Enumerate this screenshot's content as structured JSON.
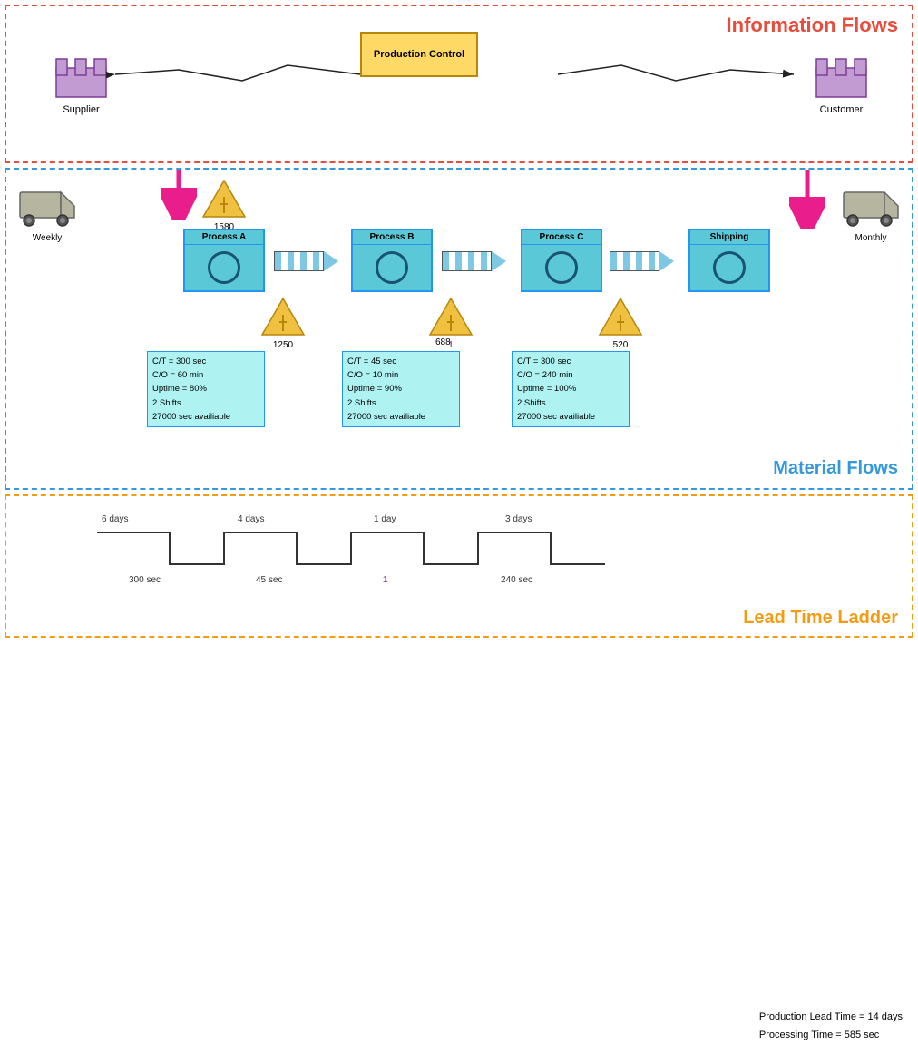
{
  "sections": {
    "info_flows": "Information Flows",
    "material_flows": "Material Flows",
    "lead_time": "Lead Time Ladder"
  },
  "production_control": {
    "label": "Production Control"
  },
  "supplier": {
    "label": "Supplier"
  },
  "customer": {
    "label": "Customer"
  },
  "truck_weekly": {
    "label": "Weekly"
  },
  "truck_monthly": {
    "label": "Monthly"
  },
  "processes": [
    {
      "id": "A",
      "title": "Process A",
      "inventory": "1580",
      "inv_below": "1250"
    },
    {
      "id": "B",
      "title": "Process B",
      "inventory": "1",
      "inv_below": "688"
    },
    {
      "id": "C",
      "title": "Process C",
      "inventory": "",
      "inv_below": "520"
    },
    {
      "id": "S",
      "title": "Shipping",
      "inventory": "",
      "inv_below": ""
    }
  ],
  "info_boxes": [
    {
      "ct": "C/T = 300 sec",
      "co": "C/O = 60 min",
      "uptime": "Uptime = 80%",
      "shifts": "2 Shifts",
      "avail": "27000 sec availiable"
    },
    {
      "ct": "C/T = 45 sec",
      "co": "C/O = 10 min",
      "uptime": "Uptime = 90%",
      "shifts": "2 Shifts",
      "avail": "27000 sec availiable"
    },
    {
      "ct": "C/T = 300 sec",
      "co": "C/O = 240 min",
      "uptime": "Uptime = 100%",
      "shifts": "2 Shifts",
      "avail": "27000 sec availiable"
    }
  ],
  "lead_time": {
    "days": [
      "6 days",
      "4 days",
      "1 day",
      "3 days"
    ],
    "secs": [
      "300 sec",
      "45 sec",
      "240 sec"
    ],
    "production_lead": "Production Lead Time = 14 days",
    "processing_time": "Processing Time = 585 sec",
    "inv_label_1": "1"
  },
  "inventory_labels": {
    "above_a": "1580",
    "below_a": "1250",
    "below_b_top": "1",
    "below_b": "688",
    "below_c": "520"
  }
}
